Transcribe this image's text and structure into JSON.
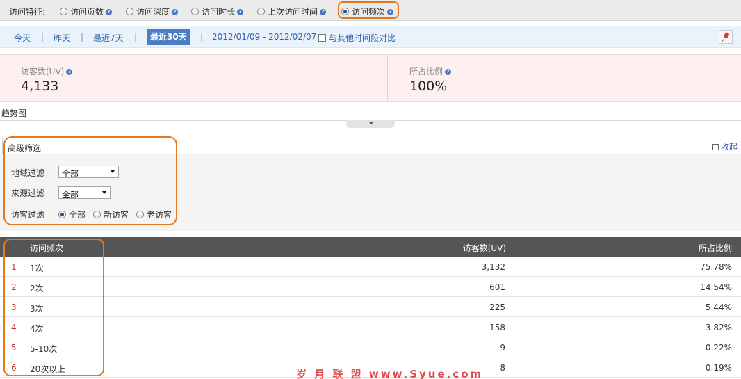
{
  "feature_bar": {
    "label": "访问特征:",
    "options": [
      {
        "label": "访问页数",
        "checked": false
      },
      {
        "label": "访问深度",
        "checked": false
      },
      {
        "label": "访问时长",
        "checked": false
      },
      {
        "label": "上次访问时间",
        "checked": false
      },
      {
        "label": "访问频次",
        "checked": true
      }
    ]
  },
  "date_bar": {
    "today": "今天",
    "yesterday": "昨天",
    "last7": "最近7天",
    "last30": "最近30天",
    "range": "2012/01/09 - 2012/02/07",
    "compare": "与其他时间段对比",
    "separator": "|"
  },
  "summary": {
    "uv_label": "访客数(UV)",
    "uv_value": "4,133",
    "ratio_label": "所占比例",
    "ratio_value": "100%"
  },
  "trend_label": "趋势图",
  "filter": {
    "tab_label": "高级筛选",
    "collapse_label": "收起",
    "region_label": "地域过滤",
    "region_value": "全部",
    "source_label": "来源过滤",
    "source_value": "全部",
    "visitor_label": "访客过滤",
    "visitor_options": [
      {
        "label": "全部",
        "checked": true
      },
      {
        "label": "新访客",
        "checked": false
      },
      {
        "label": "老访客",
        "checked": false
      }
    ]
  },
  "table": {
    "headers": [
      "访问频次",
      "访客数(UV)",
      "所占比例"
    ],
    "rows": [
      {
        "num": "1",
        "freq": "1次",
        "uv": "3,132",
        "ratio": "75.78%"
      },
      {
        "num": "2",
        "freq": "2次",
        "uv": "601",
        "ratio": "14.54%"
      },
      {
        "num": "3",
        "freq": "3次",
        "uv": "225",
        "ratio": "5.44%"
      },
      {
        "num": "4",
        "freq": "4次",
        "uv": "158",
        "ratio": "3.82%"
      },
      {
        "num": "5",
        "freq": "5-10次",
        "uv": "9",
        "ratio": "0.22%"
      },
      {
        "num": "6",
        "freq": "20次以上",
        "uv": "8",
        "ratio": "0.19%"
      }
    ]
  },
  "watermark": "岁 月 联 盟  www.Syue.com",
  "colors": {
    "highlight": "#e8781e",
    "link": "#2f62b6",
    "active_tab": "#4a7dc4",
    "table_header": "#555555"
  }
}
